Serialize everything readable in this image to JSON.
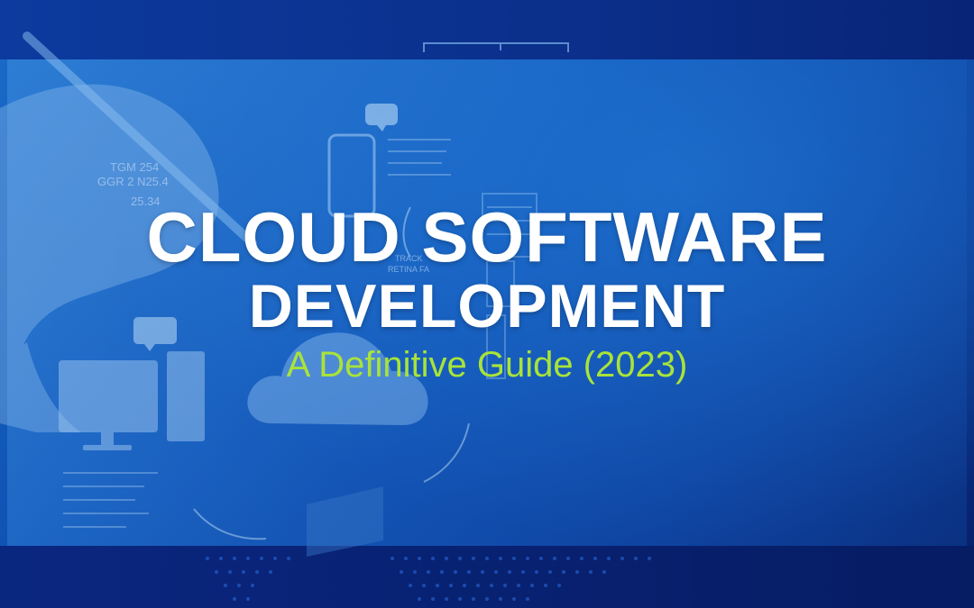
{
  "hero": {
    "title_line1": "CLOUD SOFTWARE",
    "title_line2": "DEVELOPMENT",
    "subtitle": "A Definitive Guide (2023)"
  },
  "background_text": {
    "readout_1": "TGM 254",
    "readout_2": "GGR 2  N25.4",
    "readout_3": "25.34",
    "track_1": "TRACK",
    "track_2": "RETINA FA"
  },
  "colors": {
    "title": "#ffffff",
    "subtitle": "#a9e33a",
    "background_deep": "#0a2a8a",
    "background_light": "#1a6cc8"
  },
  "icons": [
    "cloud-icon",
    "monitor-icon",
    "tower-pc-icon",
    "smartphone-icon",
    "chat-bubble-icon",
    "laptop-icon",
    "hand-icon",
    "pen-icon"
  ]
}
